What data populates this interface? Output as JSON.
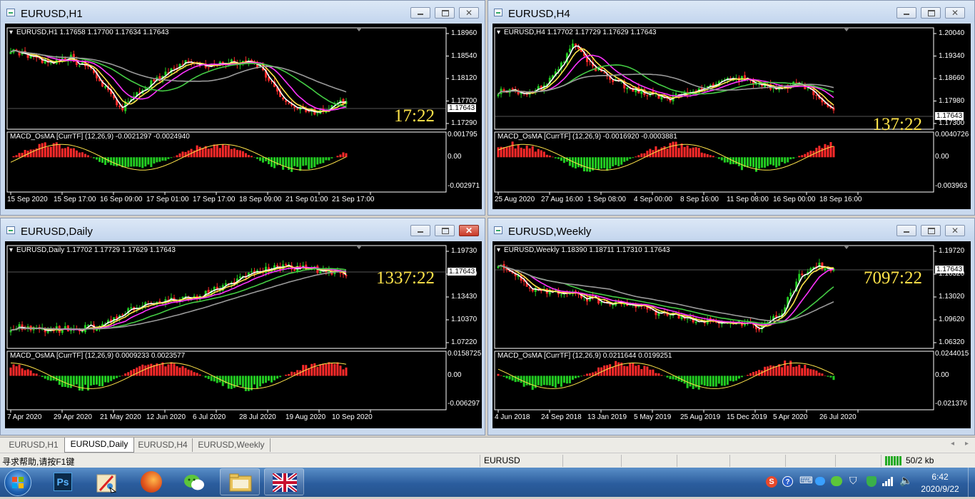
{
  "windows": [
    {
      "id": "h1",
      "title": "EURUSD,H1",
      "header": "EURUSD,H1  1.17658 1.17700 1.17634 1.17643",
      "clock": "17:22",
      "price_axis": [
        "1.18960",
        "1.18540",
        "1.18120",
        "1.17700",
        "1.17290"
      ],
      "current_price": "1.17643",
      "macd_header": "MACD_OsMA [CurrTF] (12,26,9) -0.0021297 -0.0024940",
      "macd_axis": [
        "0.001795",
        "0.00",
        "-0.002971"
      ],
      "time_axis": [
        "15 Sep 2020",
        "15 Sep 17:00",
        "16 Sep 09:00",
        "17 Sep 01:00",
        "17 Sep 17:00",
        "18 Sep 09:00",
        "21 Sep 01:00",
        "21 Sep 17:00"
      ]
    },
    {
      "id": "h4",
      "title": "EURUSD,H4",
      "header": "EURUSD,H4  1.17702 1.17729 1.17629 1.17643",
      "clock": "137:22",
      "price_axis": [
        "1.20040",
        "1.19340",
        "1.18660",
        "1.17980",
        "1.17300"
      ],
      "current_price": "1.17643",
      "macd_header": "MACD_OsMA [CurrTF] (12,26,9) -0.0016920 -0.0003881",
      "macd_axis": [
        "0.0040726",
        "0.00",
        "-0.003963"
      ],
      "time_axis": [
        "25 Aug 2020",
        "27 Aug 16:00",
        "1 Sep 08:00",
        "4 Sep 00:00",
        "8 Sep 16:00",
        "11 Sep 08:00",
        "16 Sep 00:00",
        "18 Sep 16:00"
      ]
    },
    {
      "id": "daily",
      "title": "EURUSD,Daily",
      "header": "EURUSD,Daily  1.17702 1.17729 1.17629 1.17643",
      "clock": "1337:22",
      "price_axis": [
        "1.19730",
        "1.16580",
        "1.13430",
        "1.10370",
        "1.07220"
      ],
      "current_price": "1.17643",
      "macd_header": "MACD_OsMA [CurrTF] (12,26,9) 0.0009233 0.0023577",
      "macd_axis": [
        "0.0158725",
        "0.00",
        "-0.006297"
      ],
      "time_axis": [
        "7 Apr 2020",
        "29 Apr 2020",
        "21 May 2020",
        "12 Jun 2020",
        "6 Jul 2020",
        "28 Jul 2020",
        "19 Aug 2020",
        "10 Sep 2020"
      ]
    },
    {
      "id": "weekly",
      "title": "EURUSD,Weekly",
      "header": "EURUSD,Weekly  1.18390 1.18711 1.17310 1.17643",
      "clock": "7097:22",
      "price_axis": [
        "1.19720",
        "1.16320",
        "1.13020",
        "1.09620",
        "1.06320"
      ],
      "current_price": "1.17643",
      "macd_header": "MACD_OsMA [CurrTF] (12,26,9) 0.0211644 0.0199251",
      "macd_axis": [
        "0.0244015",
        "0.00",
        "-0.021376"
      ],
      "time_axis": [
        "4 Jun 2018",
        "24 Sep 2018",
        "13 Jan 2019",
        "5 May 2019",
        "25 Aug 2019",
        "15 Dec 2019",
        "5 Apr 2020",
        "26 Jul 2020"
      ]
    }
  ],
  "tabs": [
    "EURUSD,H1",
    "EURUSD,Daily",
    "EURUSD,H4",
    "EURUSD,Weekly"
  ],
  "active_tab": "EURUSD,Daily",
  "status": {
    "help": "寻求帮助,请按F1键",
    "symbol": "EURUSD",
    "traffic": "50/2 kb"
  },
  "clock": {
    "time": "6:42",
    "date": "2020/9/22"
  },
  "taskbar_items": [
    "start-orb-icon",
    "photoshop-icon",
    "paint-app-icon",
    "firefox-icon",
    "wechat-icon",
    "file-explorer-icon",
    "uk-flag-icon"
  ],
  "colors": {
    "bull": "#ff2a2a",
    "bear": "#22cc22",
    "ma_fast": "#ffffff",
    "ma_mid": "#ffe44a",
    "ma_slow": "#ff33ff",
    "ma_long": "#44cc44",
    "ma_longest": "#9a9a9a",
    "clock": "#ffe44a"
  }
}
